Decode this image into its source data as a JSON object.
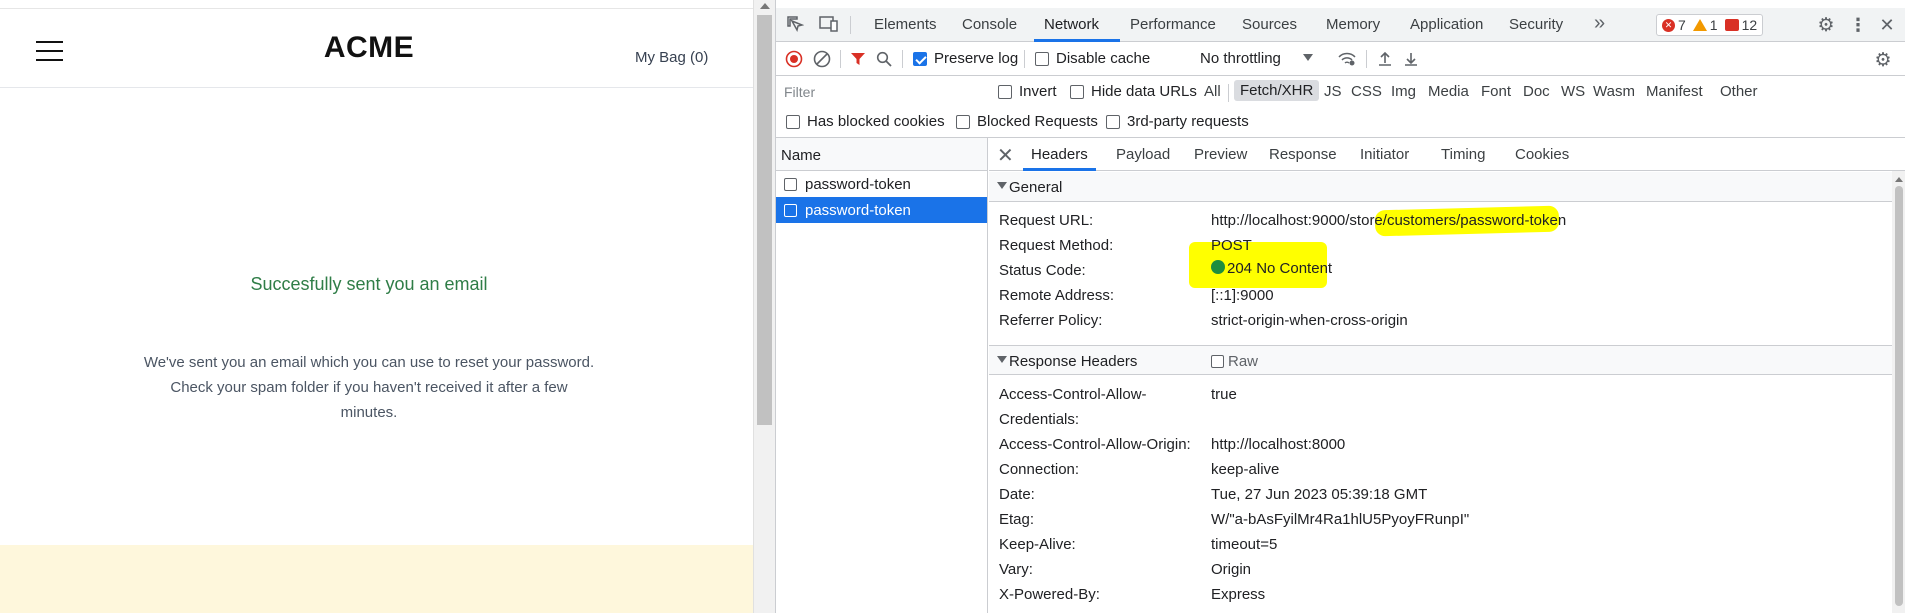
{
  "shop": {
    "brand": "ACME",
    "bag_label": "My Bag (0)",
    "success_title": "Succesfully sent you an email",
    "message_line1": "We've sent you an email which you can use to reset your password.",
    "message_line2": "Check your spam folder if you haven't received it after a few",
    "message_line3": "minutes."
  },
  "devtools": {
    "tabs": [
      "Elements",
      "Console",
      "Network",
      "Performance",
      "Sources",
      "Memory",
      "Application",
      "Security"
    ],
    "active_tab": "Network",
    "more_tabs": "»",
    "counts": {
      "errors": "7",
      "warnings": "1",
      "messages": "12"
    },
    "toolbar": {
      "preserve_log": "Preserve log",
      "disable_cache": "Disable cache",
      "throttling": "No throttling"
    },
    "filter": {
      "placeholder": "Filter",
      "invert": "Invert",
      "hide_data_urls": "Hide data URLs",
      "types": [
        "All",
        "Fetch/XHR",
        "JS",
        "CSS",
        "Img",
        "Media",
        "Font",
        "Doc",
        "WS",
        "Wasm",
        "Manifest",
        "Other"
      ],
      "active_type": "Fetch/XHR",
      "has_blocked_cookies": "Has blocked cookies",
      "blocked_requests": "Blocked Requests",
      "third_party": "3rd-party requests"
    },
    "request_list": {
      "header": "Name",
      "rows": [
        "password-token",
        "password-token"
      ],
      "selected_index": 1
    },
    "details": {
      "tabs": [
        "Headers",
        "Payload",
        "Preview",
        "Response",
        "Initiator",
        "Timing",
        "Cookies"
      ],
      "active_tab": "Headers",
      "general_title": "General",
      "general": {
        "request_url_label": "Request URL:",
        "request_url": "http://localhost:9000/store/customers/password-token",
        "method_label": "Request Method:",
        "method": "POST",
        "status_label": "Status Code:",
        "status": "204 No Content",
        "remote_label": "Remote Address:",
        "remote": "[::1]:9000",
        "referrer_label": "Referrer Policy:",
        "referrer": "strict-origin-when-cross-origin"
      },
      "response_headers_title": "Response Headers",
      "raw_label": "Raw",
      "response_headers": {
        "acac_label_1": "Access-Control-Allow-",
        "acac_label_2": "Credentials:",
        "acac": "true",
        "acao_label": "Access-Control-Allow-Origin:",
        "acao": "http://localhost:8000",
        "connection_label": "Connection:",
        "connection": "keep-alive",
        "date_label": "Date:",
        "date": "Tue, 27 Jun 2023 05:39:18 GMT",
        "etag_label": "Etag:",
        "etag": "W/\"a-bAsFyilMr4Ra1hlU5PyoyFRunpI\"",
        "keepalive_label": "Keep-Alive:",
        "keepalive": "timeout=5",
        "vary_label": "Vary:",
        "vary": "Origin",
        "powered_label": "X-Powered-By:",
        "powered": "Express"
      }
    }
  }
}
